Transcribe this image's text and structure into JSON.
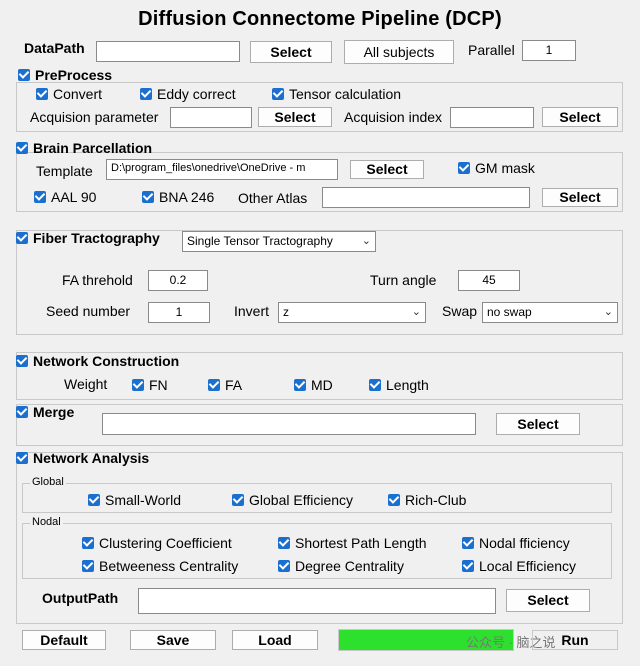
{
  "title": "Diffusion Connectome Pipeline (DCP)",
  "datapath": {
    "label": "DataPath",
    "value": "",
    "select": "Select",
    "all_subjects": "All subjects",
    "parallel_label": "Parallel",
    "parallel_value": "1"
  },
  "preprocess": {
    "header": "PreProcess",
    "convert": "Convert",
    "eddy": "Eddy correct",
    "tensor": "Tensor calculation",
    "acq_param_label": "Acquision parameter",
    "acq_param_select": "Select",
    "acq_index_label": "Acquision index",
    "acq_index_select": "Select"
  },
  "parcellation": {
    "header": "Brain Parcellation",
    "template_label": "Template",
    "template_value": "D:\\program_files\\onedrive\\OneDrive - m",
    "template_select": "Select",
    "gm_mask": "GM mask",
    "aal": "AAL 90",
    "bna": "BNA 246",
    "other_label": "Other Atlas",
    "other_select": "Select"
  },
  "tractography": {
    "header": "Fiber Tractography",
    "method": "Single Tensor Tractography",
    "fa_label": "FA threhold",
    "fa_value": "0.2",
    "turn_label": "Turn angle",
    "turn_value": "45",
    "seed_label": "Seed number",
    "seed_value": "1",
    "invert_label": "Invert",
    "invert_value": "z",
    "swap_label": "Swap",
    "swap_value": "no swap"
  },
  "network": {
    "header": "Network Construction",
    "weight_label": "Weight",
    "fn": "FN",
    "fa": "FA",
    "md": "MD",
    "length": "Length"
  },
  "merge": {
    "header": "Merge",
    "select": "Select"
  },
  "analysis": {
    "header": "Network Analysis",
    "global_label": "Global",
    "small_world": "Small-World",
    "global_eff": "Global Efficiency",
    "rich_club": "Rich-Club",
    "nodal_label": "Nodal",
    "clustering": "Clustering Coefficient",
    "shortest": "Shortest Path Length",
    "nodal_eff": "Nodal fficiency",
    "betweeness": "Betweeness Centrality",
    "degree": "Degree Centrality",
    "local_eff": "Local Efficiency",
    "output_label": "OutputPath",
    "output_select": "Select"
  },
  "bottom": {
    "default": "Default",
    "save": "Save",
    "load": "Load",
    "run": "Run",
    "progress": 1.0,
    "watermark": "公众号 · 脑之说"
  },
  "colors": {
    "progress": "#2ee02e",
    "checkbox": "#1a6fcf"
  }
}
